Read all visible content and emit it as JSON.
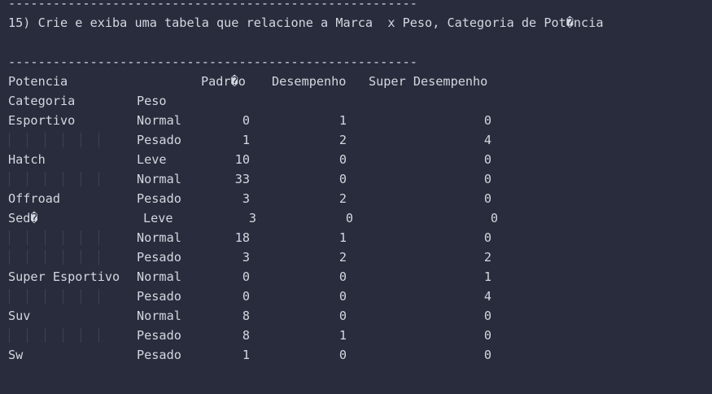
{
  "terminal": {
    "rule_top": "-------------------------------------------------------",
    "question": "15) Crie e exiba uma tabela que relacione a Marca  x Peso, Categoria de Pot�ncia",
    "rule_bottom": "-------------------------------------------------------"
  },
  "table": {
    "col_header_row1": [
      "Potencia",
      "Padr�o",
      "Desempenho",
      "Super Desempenho"
    ],
    "col_header_row2": [
      "Categoria",
      "Peso"
    ],
    "rows": [
      {
        "categoria": "Esportivo",
        "peso": "Normal",
        "padrao": "0",
        "desempenho": "1",
        "super": "0"
      },
      {
        "categoria": "",
        "peso": "Pesado",
        "padrao": "1",
        "desempenho": "2",
        "super": "4"
      },
      {
        "categoria": "Hatch",
        "peso": "Leve",
        "padrao": "10",
        "desempenho": "0",
        "super": "0"
      },
      {
        "categoria": "",
        "peso": "Normal",
        "padrao": "33",
        "desempenho": "0",
        "super": "0"
      },
      {
        "categoria": "Offroad",
        "peso": "Pesado",
        "padrao": "3",
        "desempenho": "2",
        "super": "0"
      },
      {
        "categoria": "Sed�",
        "peso": "Leve",
        "padrao": "3",
        "desempenho": "0",
        "super": "0"
      },
      {
        "categoria": "",
        "peso": "Normal",
        "padrao": "18",
        "desempenho": "1",
        "super": "0"
      },
      {
        "categoria": "",
        "peso": "Pesado",
        "padrao": "3",
        "desempenho": "2",
        "super": "2"
      },
      {
        "categoria": "Super Esportivo",
        "peso": "Normal",
        "padrao": "0",
        "desempenho": "0",
        "super": "1"
      },
      {
        "categoria": "",
        "peso": "Pesado",
        "padrao": "0",
        "desempenho": "0",
        "super": "4"
      },
      {
        "categoria": "Suv",
        "peso": "Normal",
        "padrao": "8",
        "desempenho": "0",
        "super": "0"
      },
      {
        "categoria": "",
        "peso": "Pesado",
        "padrao": "8",
        "desempenho": "1",
        "super": "0"
      },
      {
        "categoria": "Sw",
        "peso": "Pesado",
        "padrao": "1",
        "desempenho": "0",
        "super": "0"
      }
    ]
  }
}
